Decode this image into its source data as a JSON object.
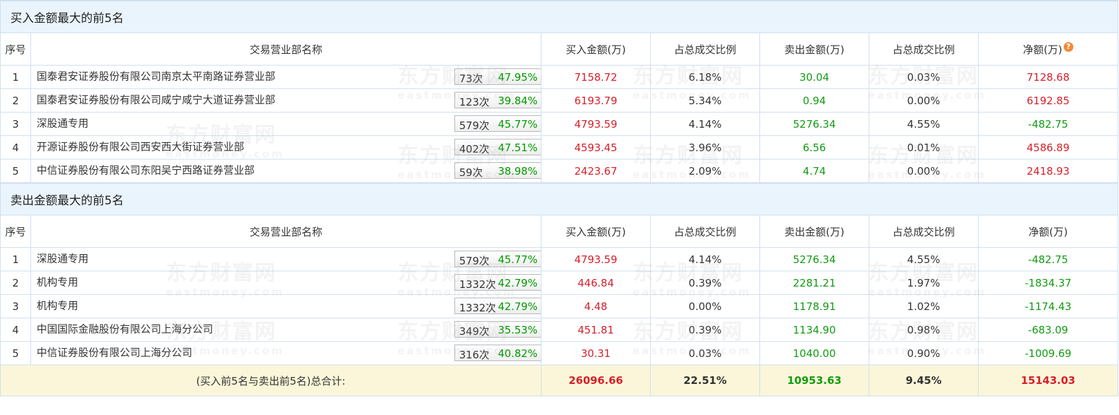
{
  "watermark": {
    "brand": "东方财富网",
    "domain": "eastmoney.com"
  },
  "buy_section": {
    "title": "买入金额最大的前5名",
    "headers": {
      "seq": "序号",
      "name": "交易营业部名称",
      "buy": "买入金额(万)",
      "buy_ratio": "占总成交比例",
      "sell": "卖出金额(万)",
      "sell_ratio": "占总成交比例",
      "net": "净额(万)"
    },
    "rows": [
      {
        "seq": "1",
        "name": "国泰君安证券股份有限公司南京太平南路证券营业部",
        "count": "73次",
        "rate": "47.95%",
        "icon": "question-icon",
        "buy": "7158.72",
        "buy_ratio": "6.18%",
        "sell": "30.04",
        "sell_ratio": "0.03%",
        "net": "7128.68",
        "net_color": "red"
      },
      {
        "seq": "2",
        "name": "国泰君安证券股份有限公司咸宁咸宁大道证券营业部",
        "count": "123次",
        "rate": "39.84%",
        "icon": "arrow-right-icon",
        "buy": "6193.79",
        "buy_ratio": "5.34%",
        "sell": "0.94",
        "sell_ratio": "0.00%",
        "net": "6192.85",
        "net_color": "red"
      },
      {
        "seq": "3",
        "name": "深股通专用",
        "count": "579次",
        "rate": "45.77%",
        "icon": "arrow-right-icon",
        "buy": "4793.59",
        "buy_ratio": "4.14%",
        "sell": "5276.34",
        "sell_ratio": "4.55%",
        "net": "-482.75",
        "net_color": "green"
      },
      {
        "seq": "4",
        "name": "开源证券股份有限公司西安西大街证券营业部",
        "count": "402次",
        "rate": "47.51%",
        "icon": "arrow-right-icon",
        "buy": "4593.45",
        "buy_ratio": "3.96%",
        "sell": "6.56",
        "sell_ratio": "0.01%",
        "net": "4586.89",
        "net_color": "red"
      },
      {
        "seq": "5",
        "name": "中信证券股份有限公司东阳吴宁西路证券营业部",
        "count": "59次",
        "rate": "38.98%",
        "icon": "arrow-right-icon",
        "buy": "2423.67",
        "buy_ratio": "2.09%",
        "sell": "4.74",
        "sell_ratio": "0.00%",
        "net": "2418.93",
        "net_color": "red"
      }
    ]
  },
  "sell_section": {
    "title": "卖出金额最大的前5名",
    "headers": {
      "seq": "序号",
      "name": "交易营业部名称",
      "buy": "买入金额(万)",
      "buy_ratio": "占总成交比例",
      "sell": "卖出金额(万)",
      "sell_ratio": "占总成交比例",
      "net": "净额(万)"
    },
    "rows": [
      {
        "seq": "1",
        "name": "深股通专用",
        "count": "579次",
        "rate": "45.77%",
        "icon": "question-icon",
        "buy": "4793.59",
        "buy_ratio": "4.14%",
        "sell": "5276.34",
        "sell_ratio": "4.55%",
        "net": "-482.75",
        "net_color": "green"
      },
      {
        "seq": "2",
        "name": "机构专用",
        "count": "1332次",
        "rate": "42.79%",
        "icon": "arrow-right-icon",
        "buy": "446.84",
        "buy_ratio": "0.39%",
        "sell": "2281.21",
        "sell_ratio": "1.97%",
        "net": "-1834.37",
        "net_color": "green"
      },
      {
        "seq": "3",
        "name": "机构专用",
        "count": "1332次",
        "rate": "42.79%",
        "icon": "arrow-right-icon",
        "buy": "4.48",
        "buy_ratio": "0.00%",
        "sell": "1178.91",
        "sell_ratio": "1.02%",
        "net": "-1174.43",
        "net_color": "green"
      },
      {
        "seq": "4",
        "name": "中国国际金融股份有限公司上海分公司",
        "count": "349次",
        "rate": "35.53%",
        "icon": "arrow-right-icon",
        "buy": "451.81",
        "buy_ratio": "0.39%",
        "sell": "1134.90",
        "sell_ratio": "0.98%",
        "net": "-683.09",
        "net_color": "green"
      },
      {
        "seq": "5",
        "name": "中信证券股份有限公司上海分公司",
        "count": "316次",
        "rate": "40.82%",
        "icon": "arrow-right-icon",
        "buy": "30.31",
        "buy_ratio": "0.03%",
        "sell": "1040.00",
        "sell_ratio": "0.90%",
        "net": "-1009.69",
        "net_color": "green"
      }
    ]
  },
  "total": {
    "label": "(买入前5名与卖出前5名)总合计:",
    "buy": "26096.66",
    "buy_ratio": "22.51%",
    "sell": "10953.63",
    "sell_ratio": "9.45%",
    "net": "15143.03"
  },
  "colors": {
    "header_bg": "#eaf4fc",
    "border": "#cfe0ef",
    "red": "#d6202a",
    "green": "#129c12",
    "total_bg": "#fbf6d9",
    "question_icon": "#f08a3c",
    "arrow_icon": "#1b4f8a"
  }
}
